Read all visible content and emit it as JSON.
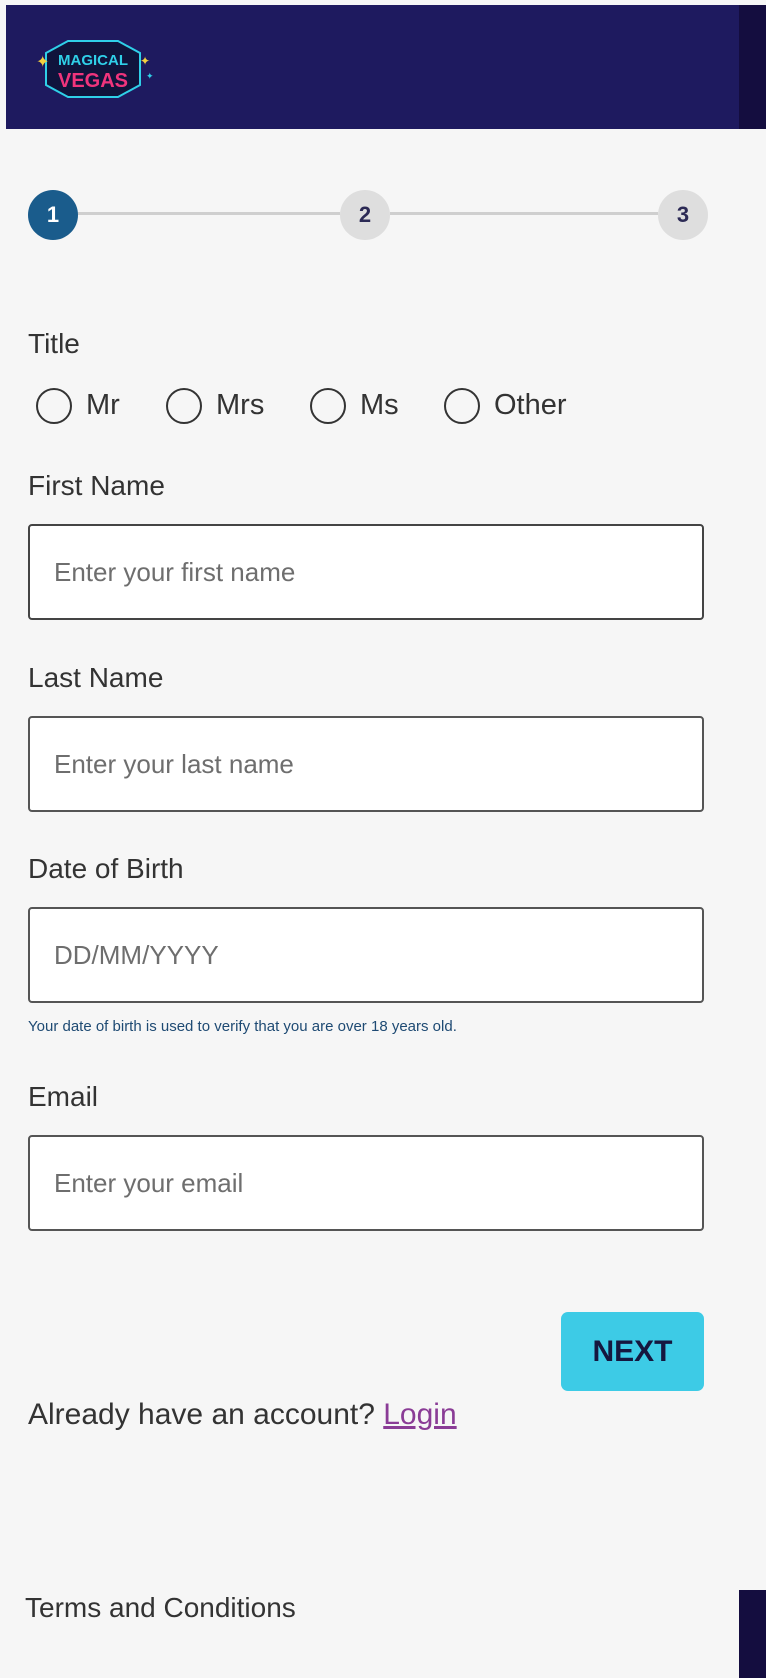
{
  "brand": {
    "logo_text_top": "MAGICAL",
    "logo_text_bottom": "VEGAS",
    "colors": {
      "header": "#1e1a5f",
      "accent": "#3dcbe6",
      "step_active": "#1a5c8c",
      "link": "#8a3c96"
    }
  },
  "stepper": {
    "steps": [
      {
        "label": "1",
        "state": "active"
      },
      {
        "label": "2",
        "state": "inactive"
      },
      {
        "label": "3",
        "state": "inactive"
      }
    ]
  },
  "form": {
    "title_label": "Title",
    "title_options": [
      "Mr",
      "Mrs",
      "Ms",
      "Other"
    ],
    "first_name": {
      "label": "First Name",
      "value": "",
      "placeholder": "Enter your first name"
    },
    "last_name": {
      "label": "Last Name",
      "value": "",
      "placeholder": "Enter your last name"
    },
    "dob": {
      "label": "Date of Birth",
      "value": "",
      "placeholder": "DD/MM/YYYY",
      "hint": "Your date of birth is used to verify that you are over 18 years old."
    },
    "email": {
      "label": "Email",
      "value": "",
      "placeholder": "Enter your email"
    },
    "next_label": "NEXT"
  },
  "account": {
    "prompt": "Already have an account?",
    "login_label": "Login"
  },
  "footer": {
    "terms_label": "Terms and Conditions"
  }
}
